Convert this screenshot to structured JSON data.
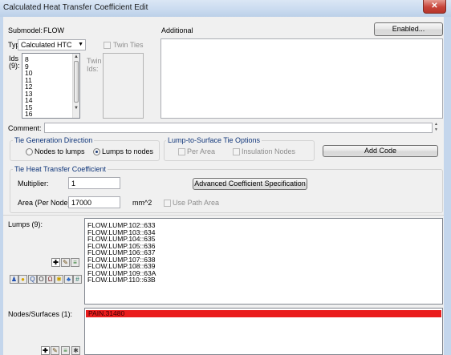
{
  "window": {
    "title": "Calculated Heat Transfer Coefficient Edit"
  },
  "submodel": {
    "label": "Submodel:",
    "value": "FLOW"
  },
  "buttons": {
    "enabled": "Enabled...",
    "add_code": "Add Code",
    "advanced": "Advanced Coefficient Specification"
  },
  "type": {
    "label": "Type:",
    "value": "Calculated HTC"
  },
  "twin_ties": {
    "label": "Twin Ties",
    "checked": false,
    "enabled": false
  },
  "additional": {
    "label": "Additional"
  },
  "ids": {
    "label": [
      "Ids",
      "(9):"
    ],
    "items": [
      "8",
      "9",
      "10",
      "11",
      "12",
      "13",
      "14",
      "15",
      "16"
    ]
  },
  "twin_ids": {
    "label": [
      "Twin",
      "Ids:"
    ],
    "enabled": false
  },
  "comment": {
    "label": "Comment:"
  },
  "tie_direction": {
    "title": "Tie Generation Direction",
    "options": [
      {
        "label": "Nodes to lumps",
        "selected": false
      },
      {
        "label": "Lumps to nodes",
        "selected": true
      }
    ]
  },
  "lump_surface": {
    "title": "Lump-to-Surface Tie Options",
    "per_area": {
      "label": "Per Area",
      "checked": false
    },
    "insulation_nodes": {
      "label": "Insulation Nodes",
      "checked": false
    }
  },
  "htc": {
    "title": "Tie Heat Transfer Coefficient",
    "multiplier": {
      "label": "Multiplier:",
      "value": "1"
    },
    "area": {
      "label": "Area (Per Node):",
      "value": "17000",
      "unit": "mm^2"
    },
    "use_path_area": {
      "label": "Use Path Area",
      "checked": false
    }
  },
  "lumps": {
    "label": "Lumps (9):",
    "items": [
      "FLOW.LUMP.102::633",
      "FLOW.LUMP.103::634",
      "FLOW.LUMP.104::635",
      "FLOW.LUMP.105::636",
      "FLOW.LUMP.106::637",
      "FLOW.LUMP.107::638",
      "FLOW.LUMP.108::639",
      "FLOW.LUMP.109::63A",
      "FLOW.LUMP.110::63B"
    ]
  },
  "nodes": {
    "label": "Nodes/Surfaces (1):",
    "items": [
      "PAIN.31480"
    ],
    "selected_index": 0
  },
  "icons": {
    "lumps_toolbar_row1": [
      "add-icon",
      "pencil-icon",
      "properties-icon"
    ],
    "lumps_toolbar_row2": [
      "people-icon",
      "bulb-icon",
      "search-icon",
      "ring-icon",
      "magnet-icon",
      "sparkle-icon",
      "tree-icon",
      "grid-icon"
    ],
    "nodes_toolbar": [
      "add-icon",
      "pencil-icon",
      "properties-icon",
      "star-icon"
    ]
  },
  "colors": {
    "title": "#c9daef",
    "close": "#c7443a",
    "bg": "#f0f0f0",
    "sel": "#ea1c1c"
  }
}
